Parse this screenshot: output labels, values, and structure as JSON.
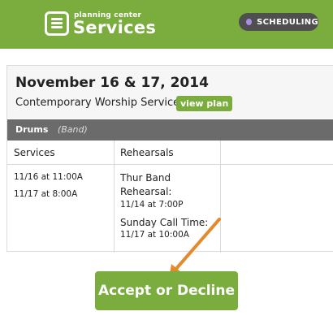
{
  "header": {
    "brand_small": "planning center",
    "brand_big": "Services",
    "badge_label": "SCHEDULING"
  },
  "plan": {
    "dates": "November 16 & 17, 2014",
    "service_type": "Contemporary Worship Service",
    "view_plan_label": "view plan"
  },
  "team": {
    "position": "Drums",
    "team": "(Band)"
  },
  "columns": {
    "services_header": "Services",
    "rehearsals_header": "Rehearsals"
  },
  "services": [
    "11/16 at 11:00A",
    "11/17 at 8:00A"
  ],
  "rehearsals": [
    {
      "label_line1": "Thur Band",
      "label_line2": "Rehearsal:",
      "time": "11/14 at 7:00P"
    },
    {
      "label_line1": "Sunday Call Time:",
      "time": "11/17 at 10:00A"
    }
  ],
  "action": {
    "accept_decline_label": "Accept or Decline"
  },
  "colors": {
    "brand_green": "#7aac3e",
    "team_bar": "#6b6b6b",
    "badge_bg": "#4f4f4f",
    "badge_dot": "#a88ee0",
    "annotation_arrow": "#e58a2c"
  }
}
